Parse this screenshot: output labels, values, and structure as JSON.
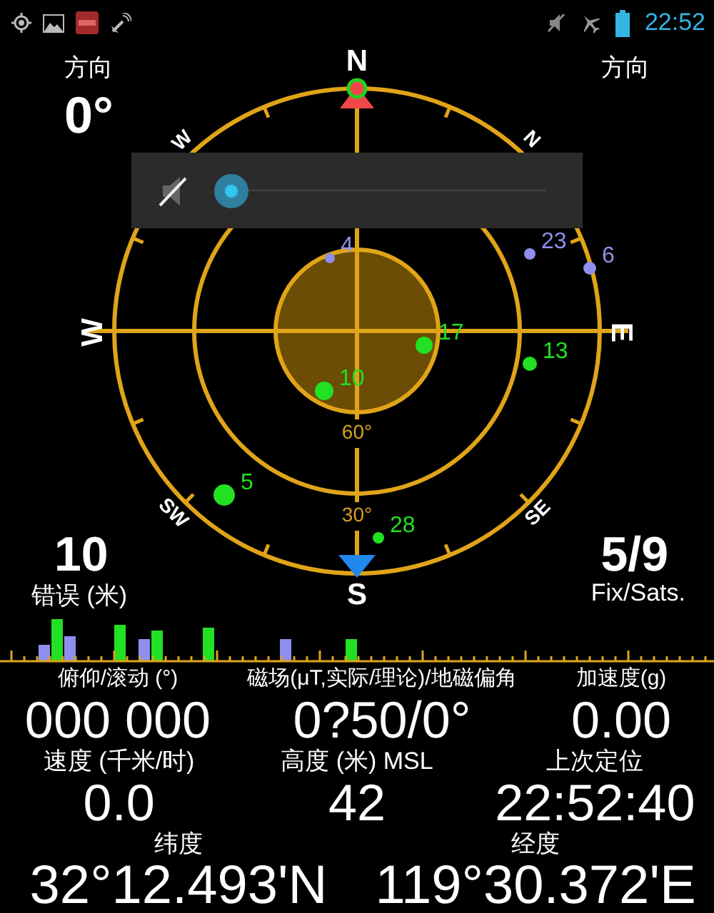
{
  "status_bar": {
    "time": "22:52"
  },
  "compass": {
    "cardinals": [
      "N",
      "E",
      "S",
      "W"
    ],
    "intercardinals": [
      "N",
      "SE",
      "SW",
      "W"
    ],
    "elevation_labels": [
      "60°",
      "30°"
    ],
    "satellites": [
      {
        "prn": "4",
        "used": false
      },
      {
        "prn": "23",
        "used": false
      },
      {
        "prn": "6",
        "used": false
      },
      {
        "prn": "17",
        "used": true
      },
      {
        "prn": "13",
        "used": true
      },
      {
        "prn": "10",
        "used": true
      },
      {
        "prn": "5",
        "used": true
      },
      {
        "prn": "28",
        "used": true
      }
    ]
  },
  "heading_left": {
    "label": "方向",
    "value": "0°"
  },
  "heading_right": {
    "label": "方向"
  },
  "accuracy": {
    "value": "10",
    "label": "错误 (米)"
  },
  "fix": {
    "value": "5/9",
    "label": "Fix/Sats."
  },
  "volume_popup": {
    "muted": true,
    "level": 0
  },
  "signal_bars": [
    {
      "used": false
    },
    {
      "used": true
    },
    {
      "used": false
    },
    {
      "used": true
    },
    {
      "used": false
    },
    {
      "used": true
    },
    {
      "used": true
    },
    {
      "used": false
    },
    {
      "used": true
    }
  ],
  "readings_top": [
    {
      "label": "俯仰/滚动 (°)",
      "value": "000 000"
    },
    {
      "label": "磁场(μT,实际/理论)/地磁偏角",
      "value": "0?50/0°"
    },
    {
      "label": "加速度(g)",
      "value": "0.00"
    }
  ],
  "readings_middle": [
    {
      "label": "速度 (千米/时)",
      "value": "0.0"
    },
    {
      "label": "高度 (米) MSL",
      "value": "42"
    },
    {
      "label": "上次定位",
      "value": "22:52:40"
    }
  ],
  "readings_bottom": [
    {
      "label": "纬度",
      "value": "32°12.493'N"
    },
    {
      "label": "经度",
      "value": "119°30.372'E"
    }
  ]
}
